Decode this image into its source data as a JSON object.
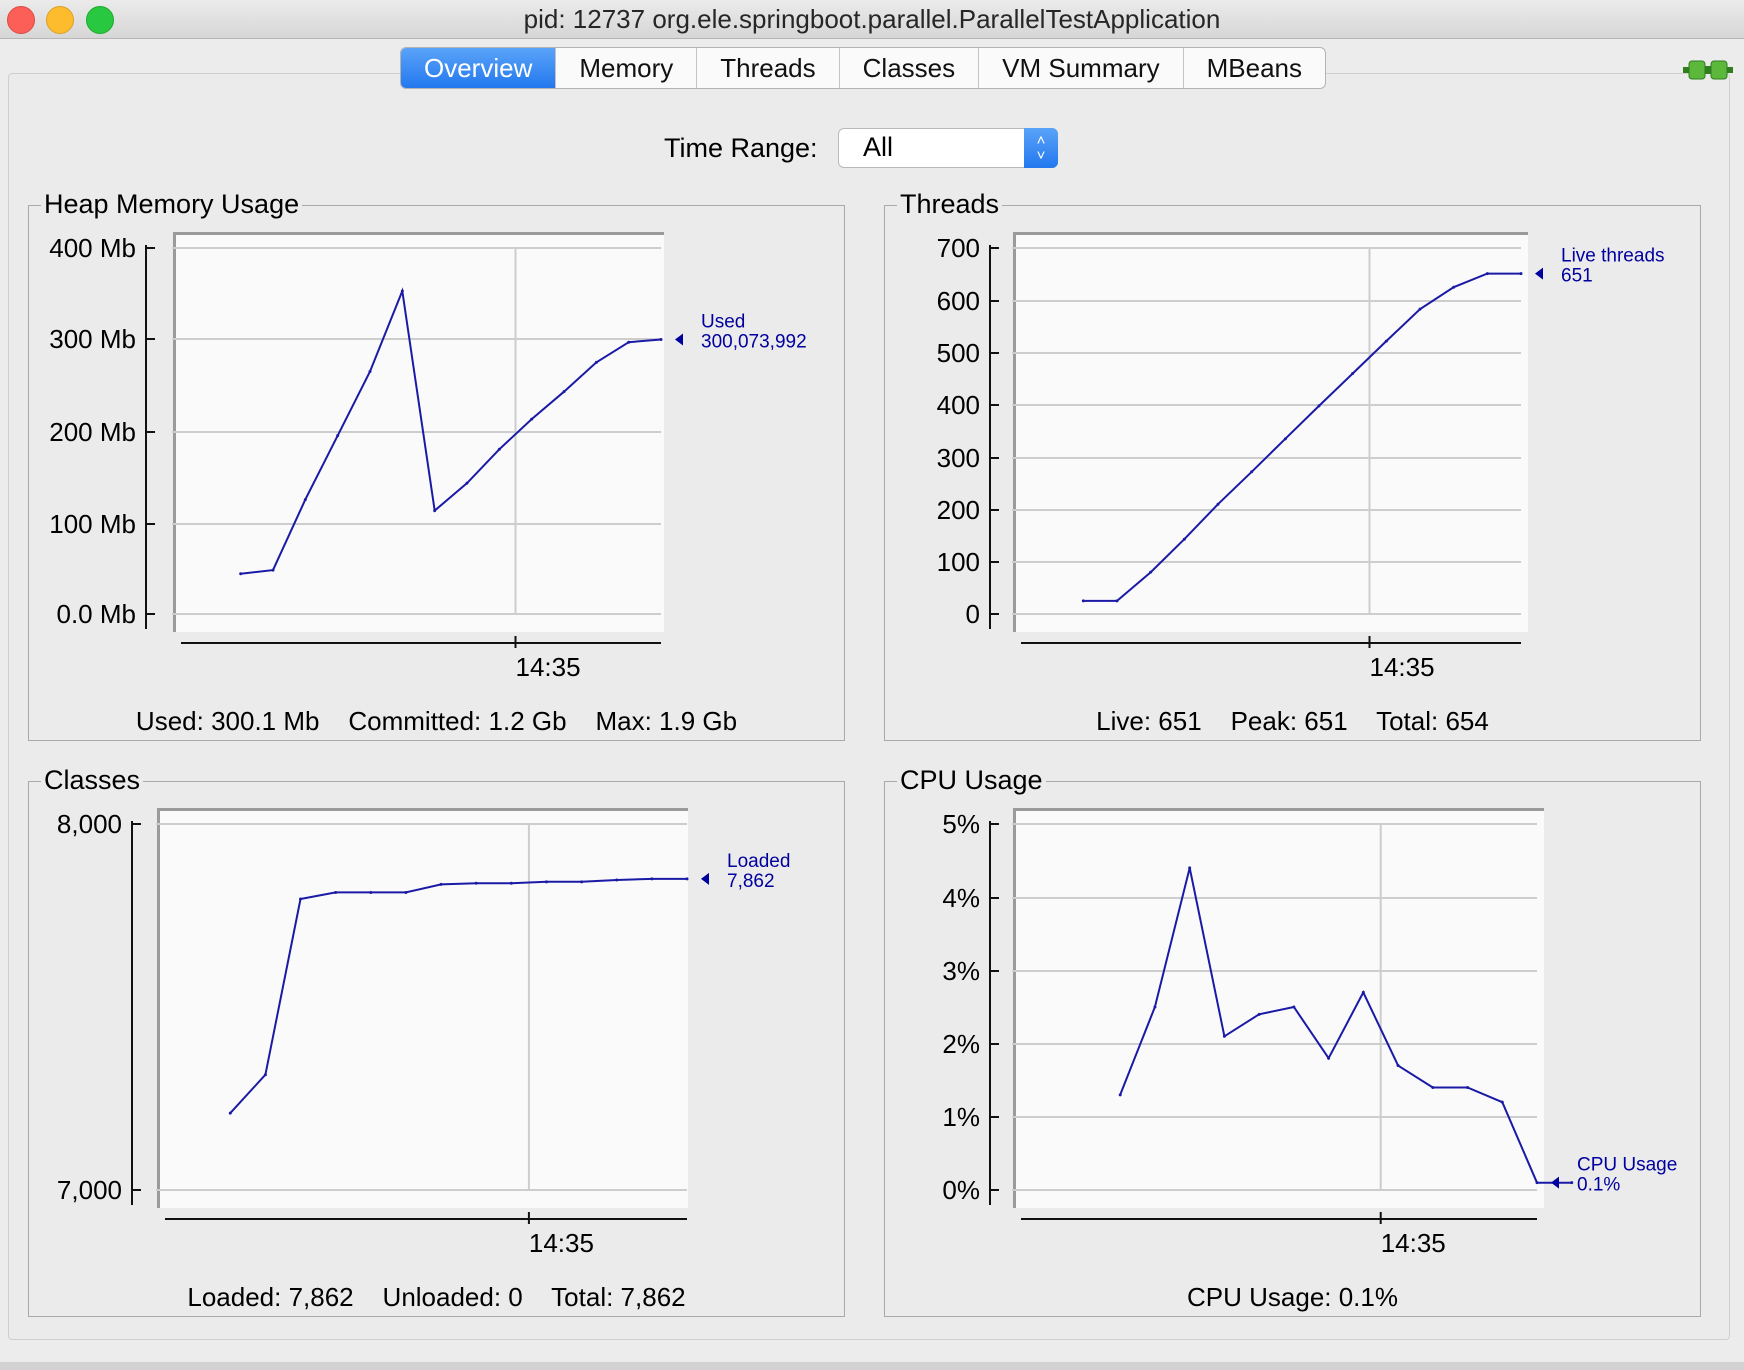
{
  "window": {
    "title": "pid: 12737 org.ele.springboot.parallel.ParallelTestApplication"
  },
  "tabs": [
    "Overview",
    "Memory",
    "Threads",
    "Classes",
    "VM Summary",
    "MBeans"
  ],
  "active_tab": "Overview",
  "time_range": {
    "label": "Time Range:",
    "value": "All"
  },
  "panels": {
    "heap": {
      "title": "Heap Memory Usage",
      "summary": "Used: 300.1 Mb    Committed: 1.2 Gb    Max: 1.9 Gb",
      "series_label": "Used",
      "series_value": "300,073,992"
    },
    "threads": {
      "title": "Threads",
      "summary": "Live: 651    Peak: 651    Total: 654",
      "series_label": "Live threads",
      "series_value": "651"
    },
    "classes": {
      "title": "Classes",
      "summary": "Loaded: 7,862    Unloaded: 0    Total: 7,862",
      "series_label": "Loaded",
      "series_value": "7,862"
    },
    "cpu": {
      "title": "CPU Usage",
      "summary": "CPU Usage: 0.1%",
      "series_label": "CPU Usage",
      "series_value": "0.1%"
    }
  },
  "colors": {
    "line": "#1a1aa6",
    "label": "#00009e",
    "accent": "#2378ee"
  },
  "chart_data": [
    {
      "type": "line",
      "id": "heap",
      "title": "Heap Memory Usage",
      "yticks": [
        "400 Mb",
        "300 Mb",
        "200 Mb",
        "100 Mb",
        "0.0 Mb"
      ],
      "ylim": [
        0,
        400
      ],
      "xlim": [
        0,
        15
      ],
      "xtick_label": "14:35",
      "xtick_at": 10.5,
      "series": [
        {
          "name": "Used",
          "x": [
            2,
            3,
            4,
            5,
            6,
            7,
            8,
            9,
            10,
            11,
            12,
            13,
            14,
            15
          ],
          "values": [
            44,
            48,
            125,
            195,
            265,
            353,
            113,
            143,
            180,
            213,
            243,
            275,
            297,
            300
          ]
        }
      ]
    },
    {
      "type": "line",
      "id": "threads",
      "title": "Threads",
      "yticks": [
        "700",
        "600",
        "500",
        "400",
        "300",
        "200",
        "100",
        "0"
      ],
      "ylim": [
        0,
        700
      ],
      "xlim": [
        0,
        15
      ],
      "xtick_label": "14:35",
      "xtick_at": 10.5,
      "series": [
        {
          "name": "Live threads",
          "x": [
            2,
            3,
            4,
            5,
            6,
            7,
            8,
            9,
            10,
            11,
            12,
            13,
            14,
            15
          ],
          "values": [
            25,
            25,
            80,
            143,
            210,
            272,
            335,
            398,
            460,
            522,
            583,
            625,
            651,
            651
          ]
        }
      ]
    },
    {
      "type": "line",
      "id": "classes",
      "title": "Classes",
      "yticks": [
        "8,000",
        "7,000"
      ],
      "ylim": [
        7000,
        8000
      ],
      "xlim": [
        0,
        15
      ],
      "xtick_label": "14:35",
      "xtick_at": 10.5,
      "series": [
        {
          "name": "Loaded",
          "x": [
            2,
            3,
            4,
            5,
            6,
            7,
            8,
            9,
            10,
            11,
            12,
            13,
            14,
            15
          ],
          "values": [
            7210,
            7315,
            7795,
            7813,
            7813,
            7813,
            7835,
            7838,
            7838,
            7842,
            7842,
            7847,
            7850,
            7850
          ]
        }
      ]
    },
    {
      "type": "line",
      "id": "cpu",
      "title": "CPU Usage",
      "yticks": [
        "5%",
        "4%",
        "3%",
        "2%",
        "1%",
        "0%"
      ],
      "ylim": [
        0,
        5
      ],
      "xlim": [
        0,
        15
      ],
      "xtick_label": "14:35",
      "xtick_at": 10.5,
      "series": [
        {
          "name": "CPU Usage",
          "x": [
            3,
            4,
            5,
            6,
            7,
            8,
            9,
            10,
            11,
            12,
            13,
            14,
            15,
            16
          ],
          "values": [
            1.3,
            2.5,
            4.4,
            2.1,
            2.4,
            2.5,
            1.8,
            2.7,
            1.7,
            1.4,
            1.4,
            1.2,
            0.1,
            0.1
          ]
        }
      ]
    }
  ]
}
